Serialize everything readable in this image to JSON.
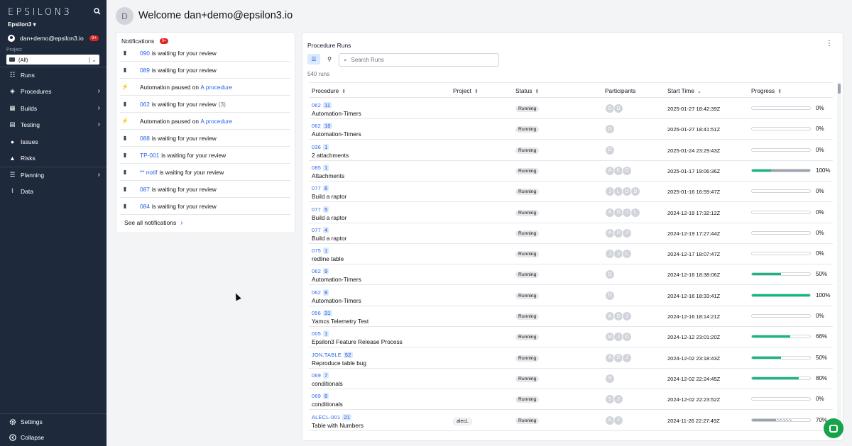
{
  "sidebar": {
    "logo": "EPSILON3",
    "org": "Epsilon3 ▾",
    "user": "dan+demo@epsilon3.io",
    "user_badge": "9+",
    "project_label": "Project",
    "project_value": "(All)",
    "nav": [
      {
        "label": "Runs",
        "icon": "list-icon",
        "chevron": false
      },
      {
        "label": "Procedures",
        "icon": "layers-icon",
        "chevron": true
      },
      {
        "label": "Builds",
        "icon": "cubes-icon",
        "chevron": true
      },
      {
        "label": "Testing",
        "icon": "clipboard-icon",
        "chevron": true
      },
      {
        "label": "Issues",
        "icon": "alert-circle-icon",
        "chevron": false
      },
      {
        "label": "Risks",
        "icon": "warning-icon",
        "chevron": false
      },
      {
        "label": "Planning",
        "icon": "bars-icon",
        "chevron": true
      },
      {
        "label": "Data",
        "icon": "chart-icon",
        "chevron": false
      }
    ],
    "settings": "Settings",
    "collapse": "Collapse"
  },
  "header": {
    "avatar": "D",
    "welcome": "Welcome dan+demo@epsilon3.io"
  },
  "notifications": {
    "title": "Notifications",
    "badge": "9+",
    "items": [
      {
        "icon": "clipboard-icon",
        "link": "090",
        "text": "is waiting for your review",
        "count": ""
      },
      {
        "icon": "clipboard-icon",
        "link": "089",
        "text": "is waiting for your review",
        "count": ""
      },
      {
        "icon": "bolt-icon",
        "prefix": "Automation paused on ",
        "link": "A procedure",
        "text": "",
        "count": ""
      },
      {
        "icon": "clipboard-icon",
        "link": "062",
        "text": "is waiting for your review",
        "count": "(3)"
      },
      {
        "icon": "bolt-icon",
        "prefix": "Automation paused on ",
        "link": "A procedure",
        "text": "",
        "count": ""
      },
      {
        "icon": "clipboard-icon",
        "link": "088",
        "text": "is waiting for your review",
        "count": ""
      },
      {
        "icon": "clipboard-icon",
        "link": "TP-001",
        "text": "is waiting for your review",
        "count": ""
      },
      {
        "icon": "clipboard-icon",
        "link": "** notif",
        "text": "is waiting for your review",
        "count": ""
      },
      {
        "icon": "clipboard-icon",
        "link": "087",
        "text": "is waiting for your review",
        "count": ""
      },
      {
        "icon": "clipboard-icon",
        "link": "084",
        "text": "is waiting for your review",
        "count": ""
      }
    ],
    "see_all": "See all notifications"
  },
  "runs": {
    "title": "Procedure Runs",
    "search_placeholder": "Search Runs",
    "count": "540 runs",
    "columns": [
      "Procedure",
      "Project",
      "Status",
      "Participants",
      "Start Time",
      "Progress"
    ],
    "rows": [
      {
        "code": "062",
        "run": "11",
        "name": "Automation-Timers",
        "project": "",
        "status": "Running",
        "participants": [
          "D",
          "D"
        ],
        "start": "2025-01-27 18:42:39Z",
        "progress": 0,
        "pct": "0%"
      },
      {
        "code": "062",
        "run": "10",
        "name": "Automation-Timers",
        "project": "",
        "status": "Running",
        "participants": [
          "D"
        ],
        "start": "2025-01-27 18:41:51Z",
        "progress": 0,
        "pct": "0%"
      },
      {
        "code": "036",
        "run": "1",
        "name": "2 attachments",
        "project": "",
        "status": "Running",
        "participants": [
          "D"
        ],
        "start": "2025-01-24 23:29:43Z",
        "progress": 0,
        "pct": "0%"
      },
      {
        "code": "085",
        "run": "1",
        "name": "Attachments",
        "project": "",
        "status": "Running",
        "participants": [
          "A",
          "K",
          "D"
        ],
        "start": "2025-01-17 19:06:36Z",
        "progress": 100,
        "pct": "100%",
        "split": 0.33
      },
      {
        "code": "077",
        "run": "6",
        "name": "Build a raptor",
        "project": "",
        "status": "Running",
        "participants": [
          "J",
          "L",
          "D",
          "D"
        ],
        "start": "2025-01-16 16:59:47Z",
        "progress": 0,
        "pct": "0%"
      },
      {
        "code": "077",
        "run": "5",
        "name": "Build a raptor",
        "project": "",
        "status": "Running",
        "participants": [
          "A",
          "D",
          "J",
          "L"
        ],
        "start": "2024-12-19 17:32:12Z",
        "progress": 0,
        "pct": "0%"
      },
      {
        "code": "077",
        "run": "4",
        "name": "Build a raptor",
        "project": "",
        "status": "Running",
        "participants": [
          "A",
          "D",
          "J"
        ],
        "start": "2024-12-19 17:27:44Z",
        "progress": 0,
        "pct": "0%"
      },
      {
        "code": "075",
        "run": "1",
        "name": "redline table",
        "project": "",
        "status": "Running",
        "participants": [
          "J",
          "J",
          "L"
        ],
        "start": "2024-12-17 18:07:47Z",
        "progress": 0,
        "pct": "0%"
      },
      {
        "code": "062",
        "run": "9",
        "name": "Automation-Timers",
        "project": "",
        "status": "Running",
        "participants": [
          "D"
        ],
        "start": "2024-12-16 18:38:06Z",
        "progress": 50,
        "pct": "50%"
      },
      {
        "code": "062",
        "run": "8",
        "name": "Automation-Timers",
        "project": "",
        "status": "Running",
        "participants": [
          "D"
        ],
        "start": "2024-12-16 18:33:41Z",
        "progress": 100,
        "pct": "100%"
      },
      {
        "code": "056",
        "run": "31",
        "name": "Yamcs Telemetry Test",
        "project": "",
        "status": "Running",
        "participants": [
          "A",
          "D",
          "J"
        ],
        "start": "2024-12-16 18:14:21Z",
        "progress": 0,
        "pct": "0%"
      },
      {
        "code": "005",
        "run": "1",
        "name": "Epsilon3 Feature Release Process",
        "project": "",
        "status": "Running",
        "participants": [
          "M",
          "J",
          "D"
        ],
        "start": "2024-12-12 23:01:20Z",
        "progress": 66,
        "pct": "66%"
      },
      {
        "code": "JON.TABLE",
        "run": "52",
        "name": "Reproduce table bug",
        "project": "",
        "status": "Running",
        "participants": [
          "A",
          "D",
          "J"
        ],
        "start": "2024-12-02 23:18:43Z",
        "progress": 50,
        "pct": "50%"
      },
      {
        "code": "069",
        "run": "7",
        "name": "conditionals",
        "project": "",
        "status": "Running",
        "participants": [
          "S"
        ],
        "start": "2024-12-02 22:24:45Z",
        "progress": 80,
        "pct": "80%"
      },
      {
        "code": "069",
        "run": "6",
        "name": "conditionals",
        "project": "",
        "status": "Running",
        "participants": [
          "S",
          "J"
        ],
        "start": "2024-12-02 22:23:52Z",
        "progress": 0,
        "pct": "0%"
      },
      {
        "code": "ALECL-001",
        "run": "21",
        "name": "Table with Numbers",
        "project": "alecL",
        "status": "Running",
        "participants": [
          "A",
          "J"
        ],
        "start": "2024-11-26 22:27:49Z",
        "progress": 70,
        "pct": "70%",
        "hatched": true
      }
    ]
  },
  "colors": {
    "sidebar": "#1e293b",
    "accent": "#2563eb",
    "progress": "#10b981",
    "badge": "#dc2626"
  }
}
